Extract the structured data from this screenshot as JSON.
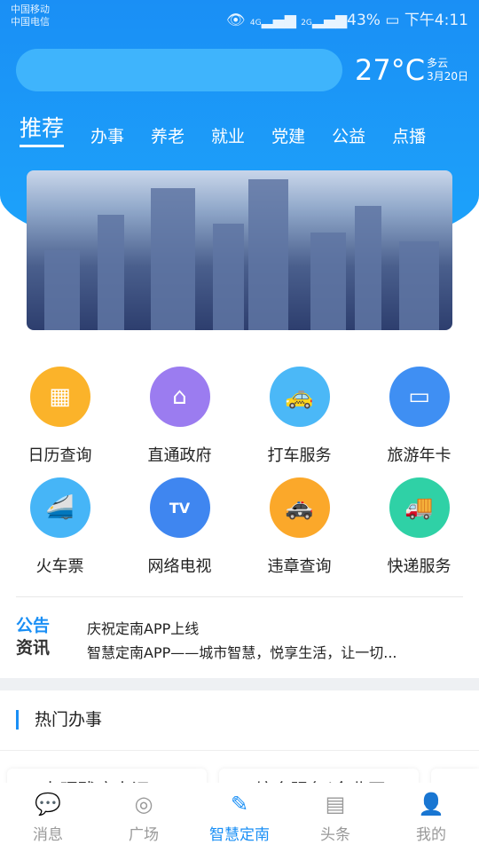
{
  "status": {
    "carrier1": "中国移动",
    "carrier2": "中国电信",
    "battery": "43%",
    "time": "下午4:11",
    "net1": "4G",
    "net2": "2G"
  },
  "weather": {
    "temp": "27°C",
    "condition": "多云",
    "date": "3月20日"
  },
  "tabs": [
    "推荐",
    "办事",
    "养老",
    "就业",
    "党建",
    "公益",
    "点播"
  ],
  "services": [
    {
      "label": "日历查询",
      "icon": "calendar-icon",
      "color": "#fbb32a"
    },
    {
      "label": "直通政府",
      "icon": "government-icon",
      "color": "#9b7cf0"
    },
    {
      "label": "打车服务",
      "icon": "taxi-icon",
      "color": "#4bb8f7"
    },
    {
      "label": "旅游年卡",
      "icon": "card-icon",
      "color": "#3f8ff3"
    },
    {
      "label": "火车票",
      "icon": "train-icon",
      "color": "#46b5f7"
    },
    {
      "label": "网络电视",
      "icon": "tv-icon",
      "color": "#3f86f0"
    },
    {
      "label": "违章查询",
      "icon": "car-icon",
      "color": "#fba82a"
    },
    {
      "label": "快递服务",
      "icon": "truck-icon",
      "color": "#2fd1a6"
    }
  ],
  "notice": {
    "tag1": "公告",
    "tag2": "资讯",
    "line1": "庆祝定南APP上线",
    "line2": "智慧定南APP——城市智慧，悦享生活，让一切..."
  },
  "hot": {
    "title": "热门办事",
    "cards": [
      "办理残疾人证",
      "综合服务(企业开",
      ""
    ]
  },
  "nav": [
    {
      "label": "消息",
      "icon": "message-icon"
    },
    {
      "label": "广场",
      "icon": "square-icon"
    },
    {
      "label": "智慧定南",
      "icon": "home-logo-icon"
    },
    {
      "label": "头条",
      "icon": "news-icon"
    },
    {
      "label": "我的",
      "icon": "profile-icon"
    }
  ]
}
